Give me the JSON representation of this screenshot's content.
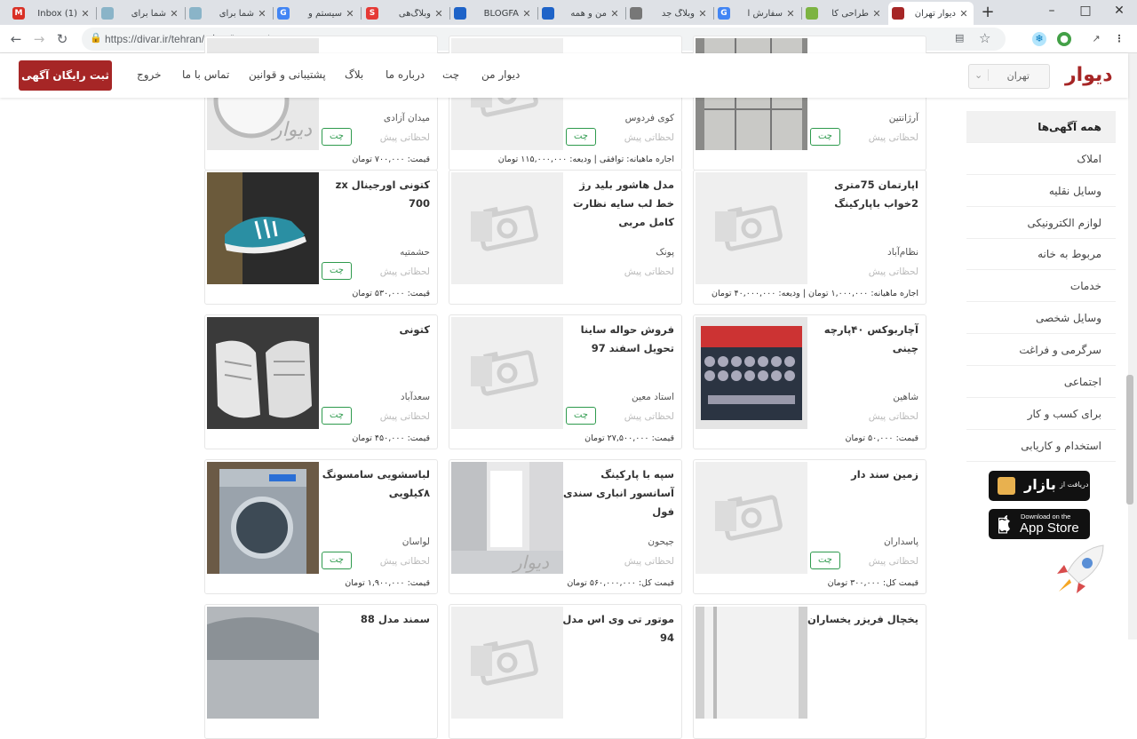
{
  "browser": {
    "tabs": [
      {
        "title": "Inbox (1)",
        "color": "#d93025",
        "glyph": "M"
      },
      {
        "title": "شما برای",
        "color": "#8ab4c8",
        "glyph": ""
      },
      {
        "title": "شما برای",
        "color": "#8ab4c8",
        "glyph": ""
      },
      {
        "title": "سیستم و",
        "color": "#4285f4",
        "glyph": "G"
      },
      {
        "title": "وبلاگ‌هی",
        "color": "#e53935",
        "glyph": "S"
      },
      {
        "title": "BLOGFA",
        "color": "#1e63c8",
        "glyph": ""
      },
      {
        "title": "من و همه",
        "color": "#1e63c8",
        "glyph": ""
      },
      {
        "title": "وبلاگ جد",
        "color": "#777777",
        "glyph": ""
      },
      {
        "title": "سفارش آ",
        "color": "#4285f4",
        "glyph": "G"
      },
      {
        "title": "طراحی کا",
        "color": "#7cb342",
        "glyph": ""
      },
      {
        "title": "دیوار تهران",
        "color": "#a62626",
        "glyph": ""
      }
    ],
    "url": "https://divar.ir/tehran/تهران/browse/"
  },
  "header": {
    "logo": "دیوار",
    "city": "تهران",
    "nav": [
      "دیوار من",
      "چت",
      "درباره ما",
      "بلاگ",
      "پشتیبانی و قوانین",
      "تماس با ما",
      "خروج"
    ],
    "post_button": "ثبت رایگان آگهی"
  },
  "sidebar": {
    "items": [
      "همه آگهی‌ها",
      "املاک",
      "وسایل نقلیه",
      "لوازم الکترونیکی",
      "مربوط به خانه",
      "خدمات",
      "وسایل شخصی",
      "سرگرمی و فراغت",
      "اجتماعی",
      "برای کسب و کار",
      "استخدام و کاریابی"
    ],
    "bazaar": {
      "small": "دریافت از",
      "big": "بازار"
    },
    "appstore": {
      "small": "Download on the",
      "big": "App Store"
    }
  },
  "cards": [
    {
      "title": "",
      "loc": "آرژانتین",
      "time": "لحظاتی پیش",
      "chat": "چت",
      "price": "",
      "img": "photo-cabinet"
    },
    {
      "title": "",
      "loc": "کوی فردوس",
      "time": "لحظاتی پیش",
      "chat": "چت",
      "price": "اجاره ماهیانه: توافقی | ودیعه: ۱۱۵,۰۰۰,۰۰۰ تومان",
      "img": "placeholder"
    },
    {
      "title": "",
      "loc": "میدان آزادی",
      "time": "لحظاتی پیش",
      "chat": "چت",
      "price": "قیمت: ۷۰۰,۰۰۰ تومان",
      "img": "photo-washer-top"
    },
    {
      "title": "اپارتمان 75متری 2خواب باپارکینگ",
      "loc": "نظام‌آباد",
      "time": "لحظاتی پیش",
      "chat": "",
      "price": "اجاره ماهیانه: ۱,۰۰۰,۰۰۰ تومان | ودیعه: ۴۰,۰۰۰,۰۰۰ تومان",
      "img": "placeholder"
    },
    {
      "title": "مدل هاشور بلید رژ خط لب سایه نظارت کامل مربی",
      "loc": "پونک",
      "time": "لحظاتی پیش",
      "chat": "",
      "price": "",
      "img": "placeholder"
    },
    {
      "title": "کتونی اورجینال zx 700",
      "loc": "حشمتیه",
      "time": "لحظاتی پیش",
      "chat": "چت",
      "price": "قیمت: ۵۳۰,۰۰۰ تومان",
      "img": "photo-sneaker"
    },
    {
      "title": "آچاربوکس ۴۰پارچه چینی",
      "loc": "شاهین",
      "time": "لحظاتی پیش",
      "chat": "",
      "price": "قیمت: ۵۰,۰۰۰ تومان",
      "img": "photo-toolbox"
    },
    {
      "title": "فروش حواله ساینا تحویل اسفند 97",
      "loc": "استاد معین",
      "time": "لحظاتی پیش",
      "chat": "چت",
      "price": "قیمت: ۲۷,۵۰۰,۰۰۰ تومان",
      "img": "placeholder"
    },
    {
      "title": "کتونی",
      "loc": "سعدآباد",
      "time": "لحظاتی پیش",
      "chat": "چت",
      "price": "قیمت: ۴۵۰,۰۰۰ تومان",
      "img": "photo-shoes"
    },
    {
      "title": "زمین سند دار",
      "loc": "پاسداران",
      "time": "لحظاتی پیش",
      "chat": "چت",
      "price": "قیمت کل: ۳۰۰,۰۰۰ تومان",
      "img": "placeholder"
    },
    {
      "title": "سپه با پارکینگ آسانسور انباری سندی فول",
      "loc": "جیحون",
      "time": "لحظاتی پیش",
      "chat": "",
      "price": "قیمت کل: ۵۶۰,۰۰۰,۰۰۰ تومان",
      "img": "photo-room"
    },
    {
      "title": "لباسشویی سامسونگ ۸کیلویی",
      "loc": "لواسان",
      "time": "لحظاتی پیش",
      "chat": "چت",
      "price": "قیمت: ۱,۹۰۰,۰۰۰ تومان",
      "img": "photo-washer"
    },
    {
      "title": "یخچال فریزر یخساران",
      "loc": "",
      "time": "",
      "chat": "",
      "price": "",
      "img": "photo-fridge"
    },
    {
      "title": "موتور تی وی اس مدل 94",
      "loc": "",
      "time": "",
      "chat": "",
      "price": "",
      "img": "placeholder"
    },
    {
      "title": "سمند مدل 88",
      "loc": "",
      "time": "",
      "chat": "",
      "price": "",
      "img": "photo-car"
    }
  ],
  "colors": {
    "brand": "#a62626",
    "chat": "#2e9a4d"
  }
}
